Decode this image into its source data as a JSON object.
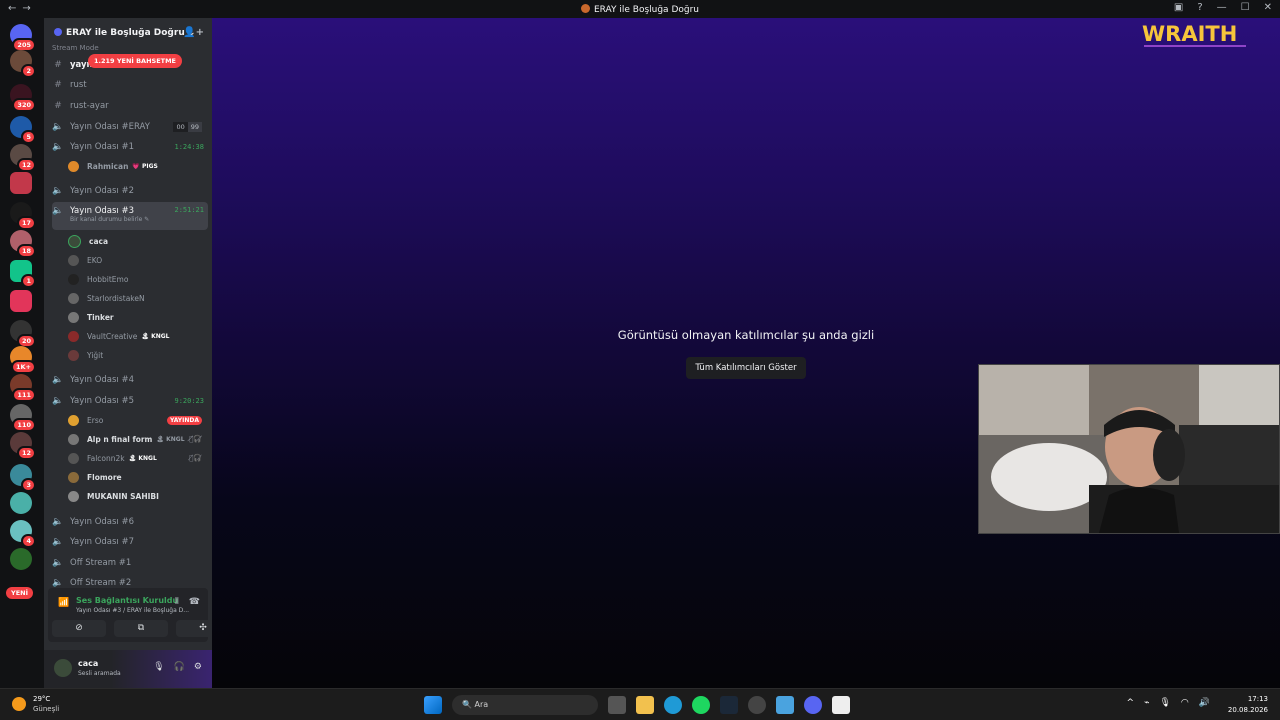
{
  "window": {
    "title": "ERAY ile Boşluğa Doğru"
  },
  "server": {
    "name": "ERAY ile Boşluğa Doğru",
    "faded_label": "Stream Mode",
    "mention_pill": "1.219 YENİ BAHSETME"
  },
  "rail_badges": [
    "205",
    "2",
    "320",
    "5",
    "12",
    "17",
    "18",
    "1",
    "20",
    "1K+",
    "111",
    "110",
    "12",
    "3",
    "4"
  ],
  "rail_new": "YENİ",
  "channels": {
    "text": [
      "yayın",
      "rust",
      "rust-ayar"
    ],
    "voice": [
      {
        "name": "Yayın Odası #ERAY",
        "counts": [
          "00",
          "99"
        ]
      },
      {
        "name": "Yayın Odası #1",
        "time": "1:24:38",
        "users": [
          {
            "name": "Rahmican",
            "tag": "💗 PIGS"
          }
        ]
      },
      {
        "name": "Yayın Odası #2"
      },
      {
        "name": "Yayın Odası #3",
        "time": "2:51:21",
        "status": "Bir kanal durumu belirle ✎",
        "users": [
          {
            "name": "caca"
          },
          {
            "name": "EKO"
          },
          {
            "name": "HobbitEmo"
          },
          {
            "name": "StarlordistakeN"
          },
          {
            "name": "Tinker"
          },
          {
            "name": "VaultCreative",
            "tag": "🏝 KNGL"
          },
          {
            "name": "Yiğit"
          }
        ]
      },
      {
        "name": "Yayın Odası #4"
      },
      {
        "name": "Yayın Odası #5",
        "time": "9:20:23",
        "users": [
          {
            "name": "Erso",
            "live": "YAYINDA"
          },
          {
            "name": "Alp n final form",
            "tag": "🏝 KNGL"
          },
          {
            "name": "Falconn2k",
            "tag": "🏝 KNGL"
          },
          {
            "name": "Flomore"
          },
          {
            "name": "MUKANIN SAHIBI"
          }
        ]
      },
      {
        "name": "Yayın Odası #6"
      },
      {
        "name": "Yayın Odası #7"
      },
      {
        "name": "Off Stream #1"
      },
      {
        "name": "Off Stream #2"
      }
    ]
  },
  "voice_panel": {
    "status": "Ses Bağlantısı Kuruldu",
    "location": "Yayın Odası #3 / ERAY ile Boşluğa D..."
  },
  "user_panel": {
    "name": "caca",
    "status": "Sesli aramada"
  },
  "main": {
    "hidden_message": "Görüntüsü olmayan katılımcılar şu anda gizli",
    "show_all_button": "Tüm Katılımcıları Göster",
    "brand": "WRAITH"
  },
  "taskbar": {
    "temp": "29°C",
    "weather": "Güneşli",
    "search": "Ara",
    "time": "17:13",
    "date": "20.08.2026"
  },
  "colors": {
    "online": "#3ba55d",
    "danger": "#f23f43",
    "brand_gold": "#f6c53b",
    "blurple": "#5865f2"
  }
}
